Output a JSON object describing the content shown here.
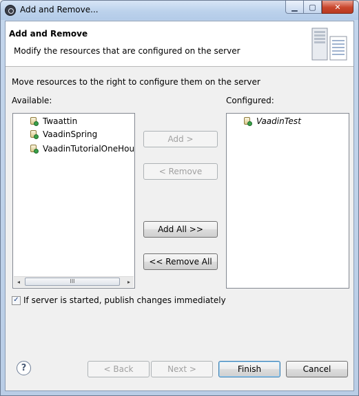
{
  "window": {
    "title": "Add and Remove...",
    "min_glyph": "▁",
    "max_glyph": "▢",
    "close_glyph": "✕"
  },
  "header": {
    "title": "Add and Remove",
    "description": "Modify the resources that are configured on the server"
  },
  "instruction": "Move resources to the right to configure them on the server",
  "available": {
    "label": "Available:",
    "items": [
      "Twaattin",
      "VaadinSpring",
      "VaadinTutorialOneHour"
    ]
  },
  "configured": {
    "label": "Configured:",
    "items": [
      "VaadinTest"
    ]
  },
  "buttons": {
    "add": "Add >",
    "remove": "< Remove",
    "add_all": "Add All >>",
    "remove_all": "<< Remove All"
  },
  "scrollbar": {
    "left_arrow": "◂",
    "right_arrow": "▸",
    "thumb_grip": "III"
  },
  "publish_checkbox": {
    "label": "If server is started, publish changes immediately",
    "checked": true,
    "check_glyph": "✓"
  },
  "footer": {
    "help_glyph": "?",
    "back": "< Back",
    "next": "Next >",
    "finish": "Finish",
    "cancel": "Cancel"
  },
  "colors": {
    "title_bar": "#bcd2ec",
    "close_button": "#c9462c",
    "dialog_background": "#f0f0f0",
    "default_button_border": "#3c7fb1"
  }
}
